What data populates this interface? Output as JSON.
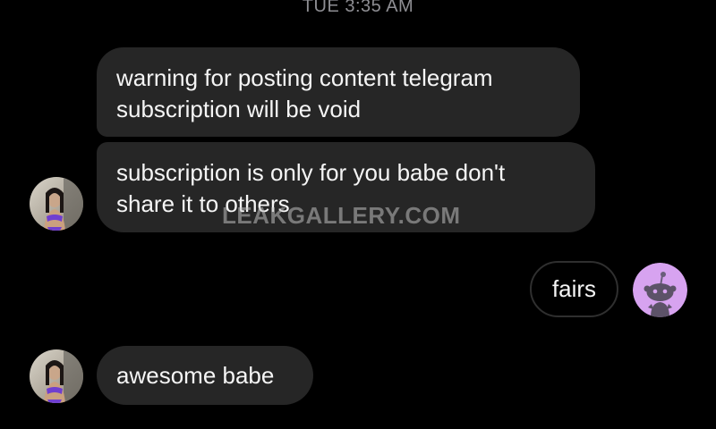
{
  "header": {
    "timestamp": "TUE 3:35 AM"
  },
  "messages": [
    {
      "sender": "other",
      "lines": [
        "warning for posting content telegram",
        "subscription will be void"
      ]
    },
    {
      "sender": "other",
      "lines": [
        "subscription is only for you babe don't",
        "share it to others"
      ]
    },
    {
      "sender": "me",
      "lines": [
        "fairs"
      ]
    },
    {
      "sender": "other",
      "lines": [
        "awesome babe"
      ]
    }
  ],
  "watermark": {
    "text": "LEAKGALLERY.COM"
  },
  "avatars": {
    "other_icon": "profile-photo",
    "me_icon": "reddit-snoo-avatar"
  },
  "colors": {
    "background": "#000000",
    "bubble_other": "#262626",
    "bubble_me_border": "#2f2f2f",
    "timestamp": "#8e8e93",
    "me_avatar_bg": "#d7a3f0"
  }
}
